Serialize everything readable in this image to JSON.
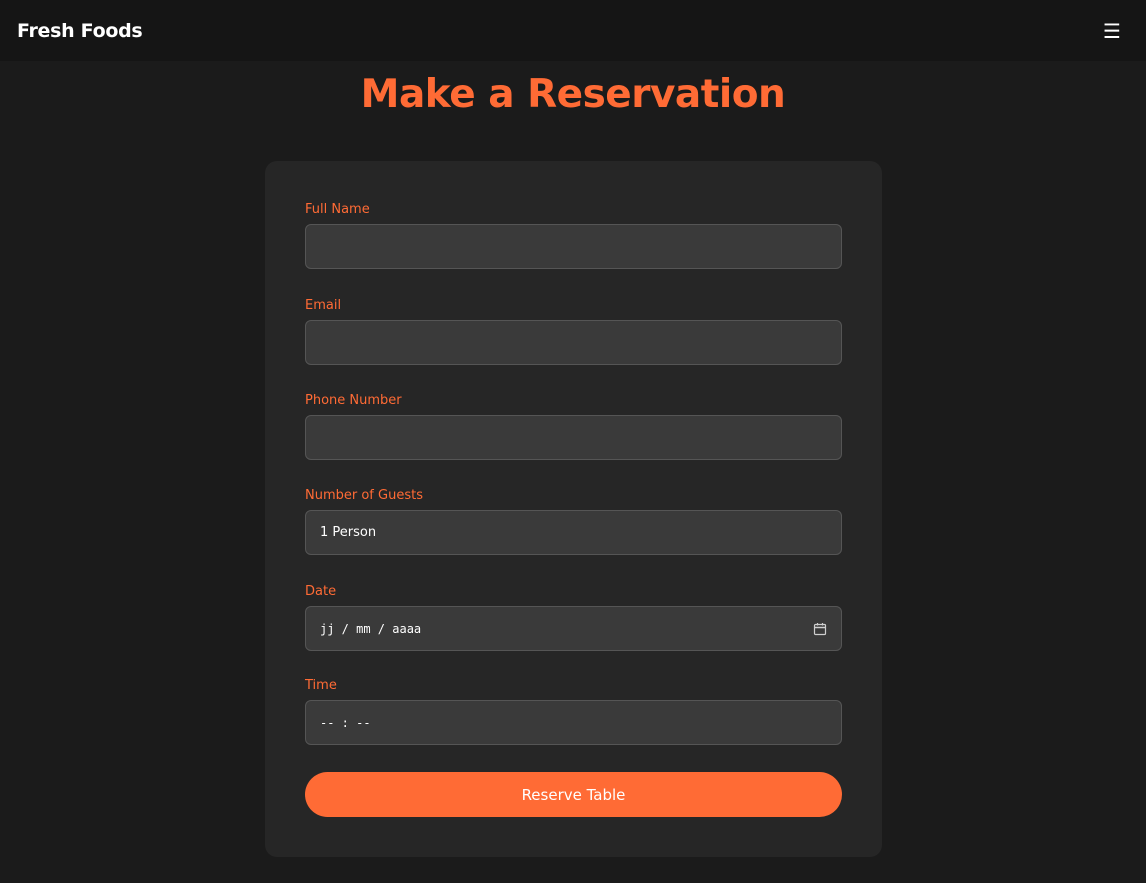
{
  "navbar": {
    "brand": "Fresh Foods",
    "menu_icon": "☰"
  },
  "page": {
    "title": "Make a Reservation"
  },
  "form": {
    "full_name": {
      "label": "Full Name",
      "value": ""
    },
    "email": {
      "label": "Email",
      "value": ""
    },
    "phone": {
      "label": "Phone Number",
      "value": ""
    },
    "guests": {
      "label": "Number of Guests",
      "selected": "1 Person"
    },
    "date": {
      "label": "Date",
      "placeholder": "jj / mm / aaaa"
    },
    "time": {
      "label": "Time",
      "placeholder": "-- : --"
    },
    "submit_label": "Reserve Table"
  },
  "colors": {
    "accent": "#ff6b35",
    "background": "#1b1b1b",
    "card": "#262626",
    "input": "#3a3a3a"
  },
  "icons": {
    "menu": "hamburger-menu-icon",
    "date": "calendar-icon"
  }
}
